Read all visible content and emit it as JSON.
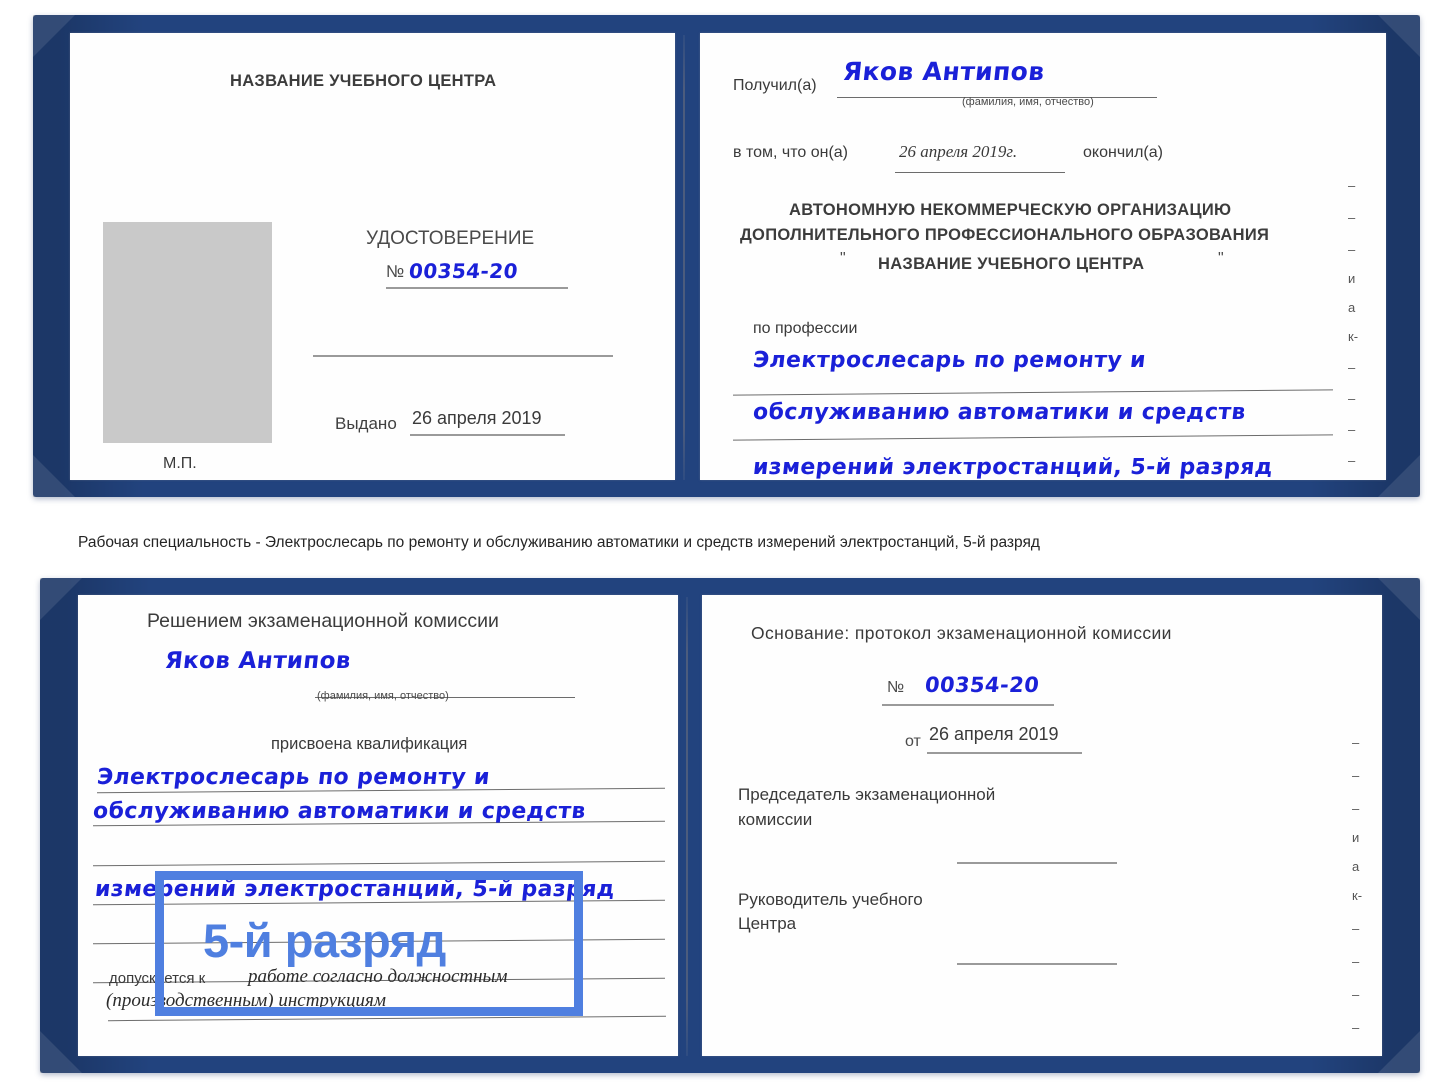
{
  "colors": {
    "cover_blue": "#22437e",
    "handwriting_blue": "#1a20d8",
    "highlight_blue": "#4f7fe0",
    "photo_placeholder_gray": "#c9c9c9"
  },
  "caption": {
    "text": "Рабочая специальность - Электрослесарь по ремонту и обслуживанию автоматики и средств измерений электростанций, 5-й разряд"
  },
  "annotation": {
    "label": "5-й разряд"
  },
  "certificate_top": {
    "left_page": {
      "heading": "НАЗВАНИЕ УЧЕБНОГО ЦЕНТРА",
      "doc_type": "УДОСТОВЕРЕНИЕ",
      "number_label": "№",
      "number_value": "00354-20",
      "issued_label": "Выдано",
      "issued_value": "26 апреля 2019",
      "stamp_label": "М.П.",
      "photo_placeholder": ""
    },
    "right_page": {
      "received_label": "Получил(а)",
      "received_value": "Яков Антипов",
      "received_hint": "(фамилия, имя, отчество)",
      "in_that_label": "в том, что он(а)",
      "in_that_value": "26 апреля 2019г.",
      "finished_label": "окончил(а)",
      "org_line1": "АВТОНОМНУЮ НЕКОММЕРЧЕСКУЮ ОРГАНИЗАЦИЮ",
      "org_line2": "ДОПОЛНИТЕЛЬНОГО ПРОФЕССИОНАЛЬНОГО ОБРАЗОВАНИЯ",
      "org_quote_open": "\"",
      "org_line3": "НАЗВАНИЕ УЧЕБНОГО ЦЕНТРА",
      "org_quote_close": "\"",
      "profession_label": "по профессии",
      "profession_line1": "Электрослесарь по ремонту и",
      "profession_line2": "обслуживанию автоматики и средств",
      "profession_line3": "измерений электростанций, 5-й разряд",
      "edge_fragments": [
        "–",
        "–",
        "–",
        "и",
        "а",
        "к-",
        "–",
        "–",
        "–",
        "–"
      ]
    }
  },
  "certificate_bottom": {
    "left_page": {
      "heading": "Решением экзаменационной комиссии",
      "name_value": "Яков Антипов",
      "name_hint": "(фамилия, имя, отчество)",
      "qualification_label": "присвоена квалификация",
      "qual_line1": "Электрослесарь по ремонту и",
      "qual_line2": "обслуживанию автоматики и средств",
      "qual_line3": "измерений электростанций, 5-й разряд",
      "admitted_label": "допускается к",
      "admitted_value1": "работе согласно должностным",
      "admitted_value2": "(производственным) инструкциям"
    },
    "right_page": {
      "basis_label": "Основание: протокол экзаменационной комиссии",
      "number_label": "№",
      "number_value": "00354-20",
      "date_label": "от",
      "date_value": "26 апреля 2019",
      "chairman_line1": "Председатель экзаменационной",
      "chairman_line2": "комиссии",
      "head_line1": "Руководитель учебного",
      "head_line2": "Центра",
      "edge_fragments": [
        "–",
        "–",
        "–",
        "и",
        "а",
        "к-",
        "–",
        "–",
        "–",
        "–"
      ]
    }
  }
}
